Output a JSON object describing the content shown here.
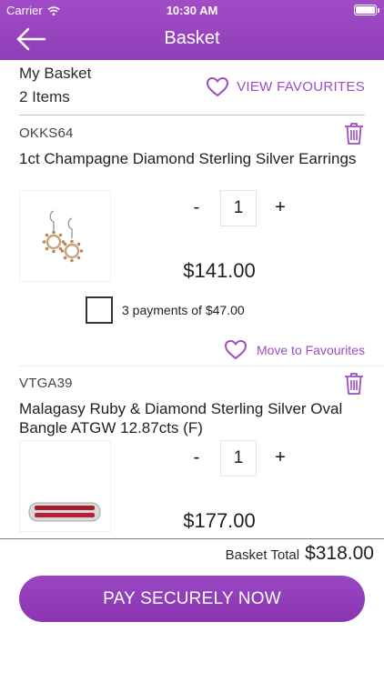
{
  "status_bar": {
    "carrier": "Carrier",
    "time": "10:30 AM"
  },
  "nav": {
    "title": "Basket"
  },
  "summary": {
    "heading": "My Basket",
    "item_count": "2 Items",
    "view_favourites_label": "VIEW FAVOURITES"
  },
  "items": [
    {
      "sku": "OKKS64",
      "name": "1ct Champagne Diamond Sterling Silver Earrings",
      "quantity": "1",
      "price": "$141.00",
      "payment_option": "3 payments of $47.00",
      "payment_option_checked": false,
      "move_to_favourites_label": "Move to Favourites"
    },
    {
      "sku": "VTGA39",
      "name": "Malagasy Ruby & Diamond Sterling Silver Oval Bangle ATGW 12.87cts (F)",
      "quantity": "1",
      "price": "$177.00"
    }
  ],
  "qty_controls": {
    "minus": "-",
    "plus": "+"
  },
  "footer": {
    "total_label": "Basket Total",
    "total_value": "$318.00",
    "pay_button_label": "PAY SECURELY NOW"
  },
  "colors": {
    "brand": "#9b4ec2",
    "header": "#9644bd"
  },
  "icons": [
    "wifi-icon",
    "battery-icon",
    "back-arrow-icon",
    "heart-outline-icon",
    "trash-icon",
    "checkbox-icon"
  ]
}
